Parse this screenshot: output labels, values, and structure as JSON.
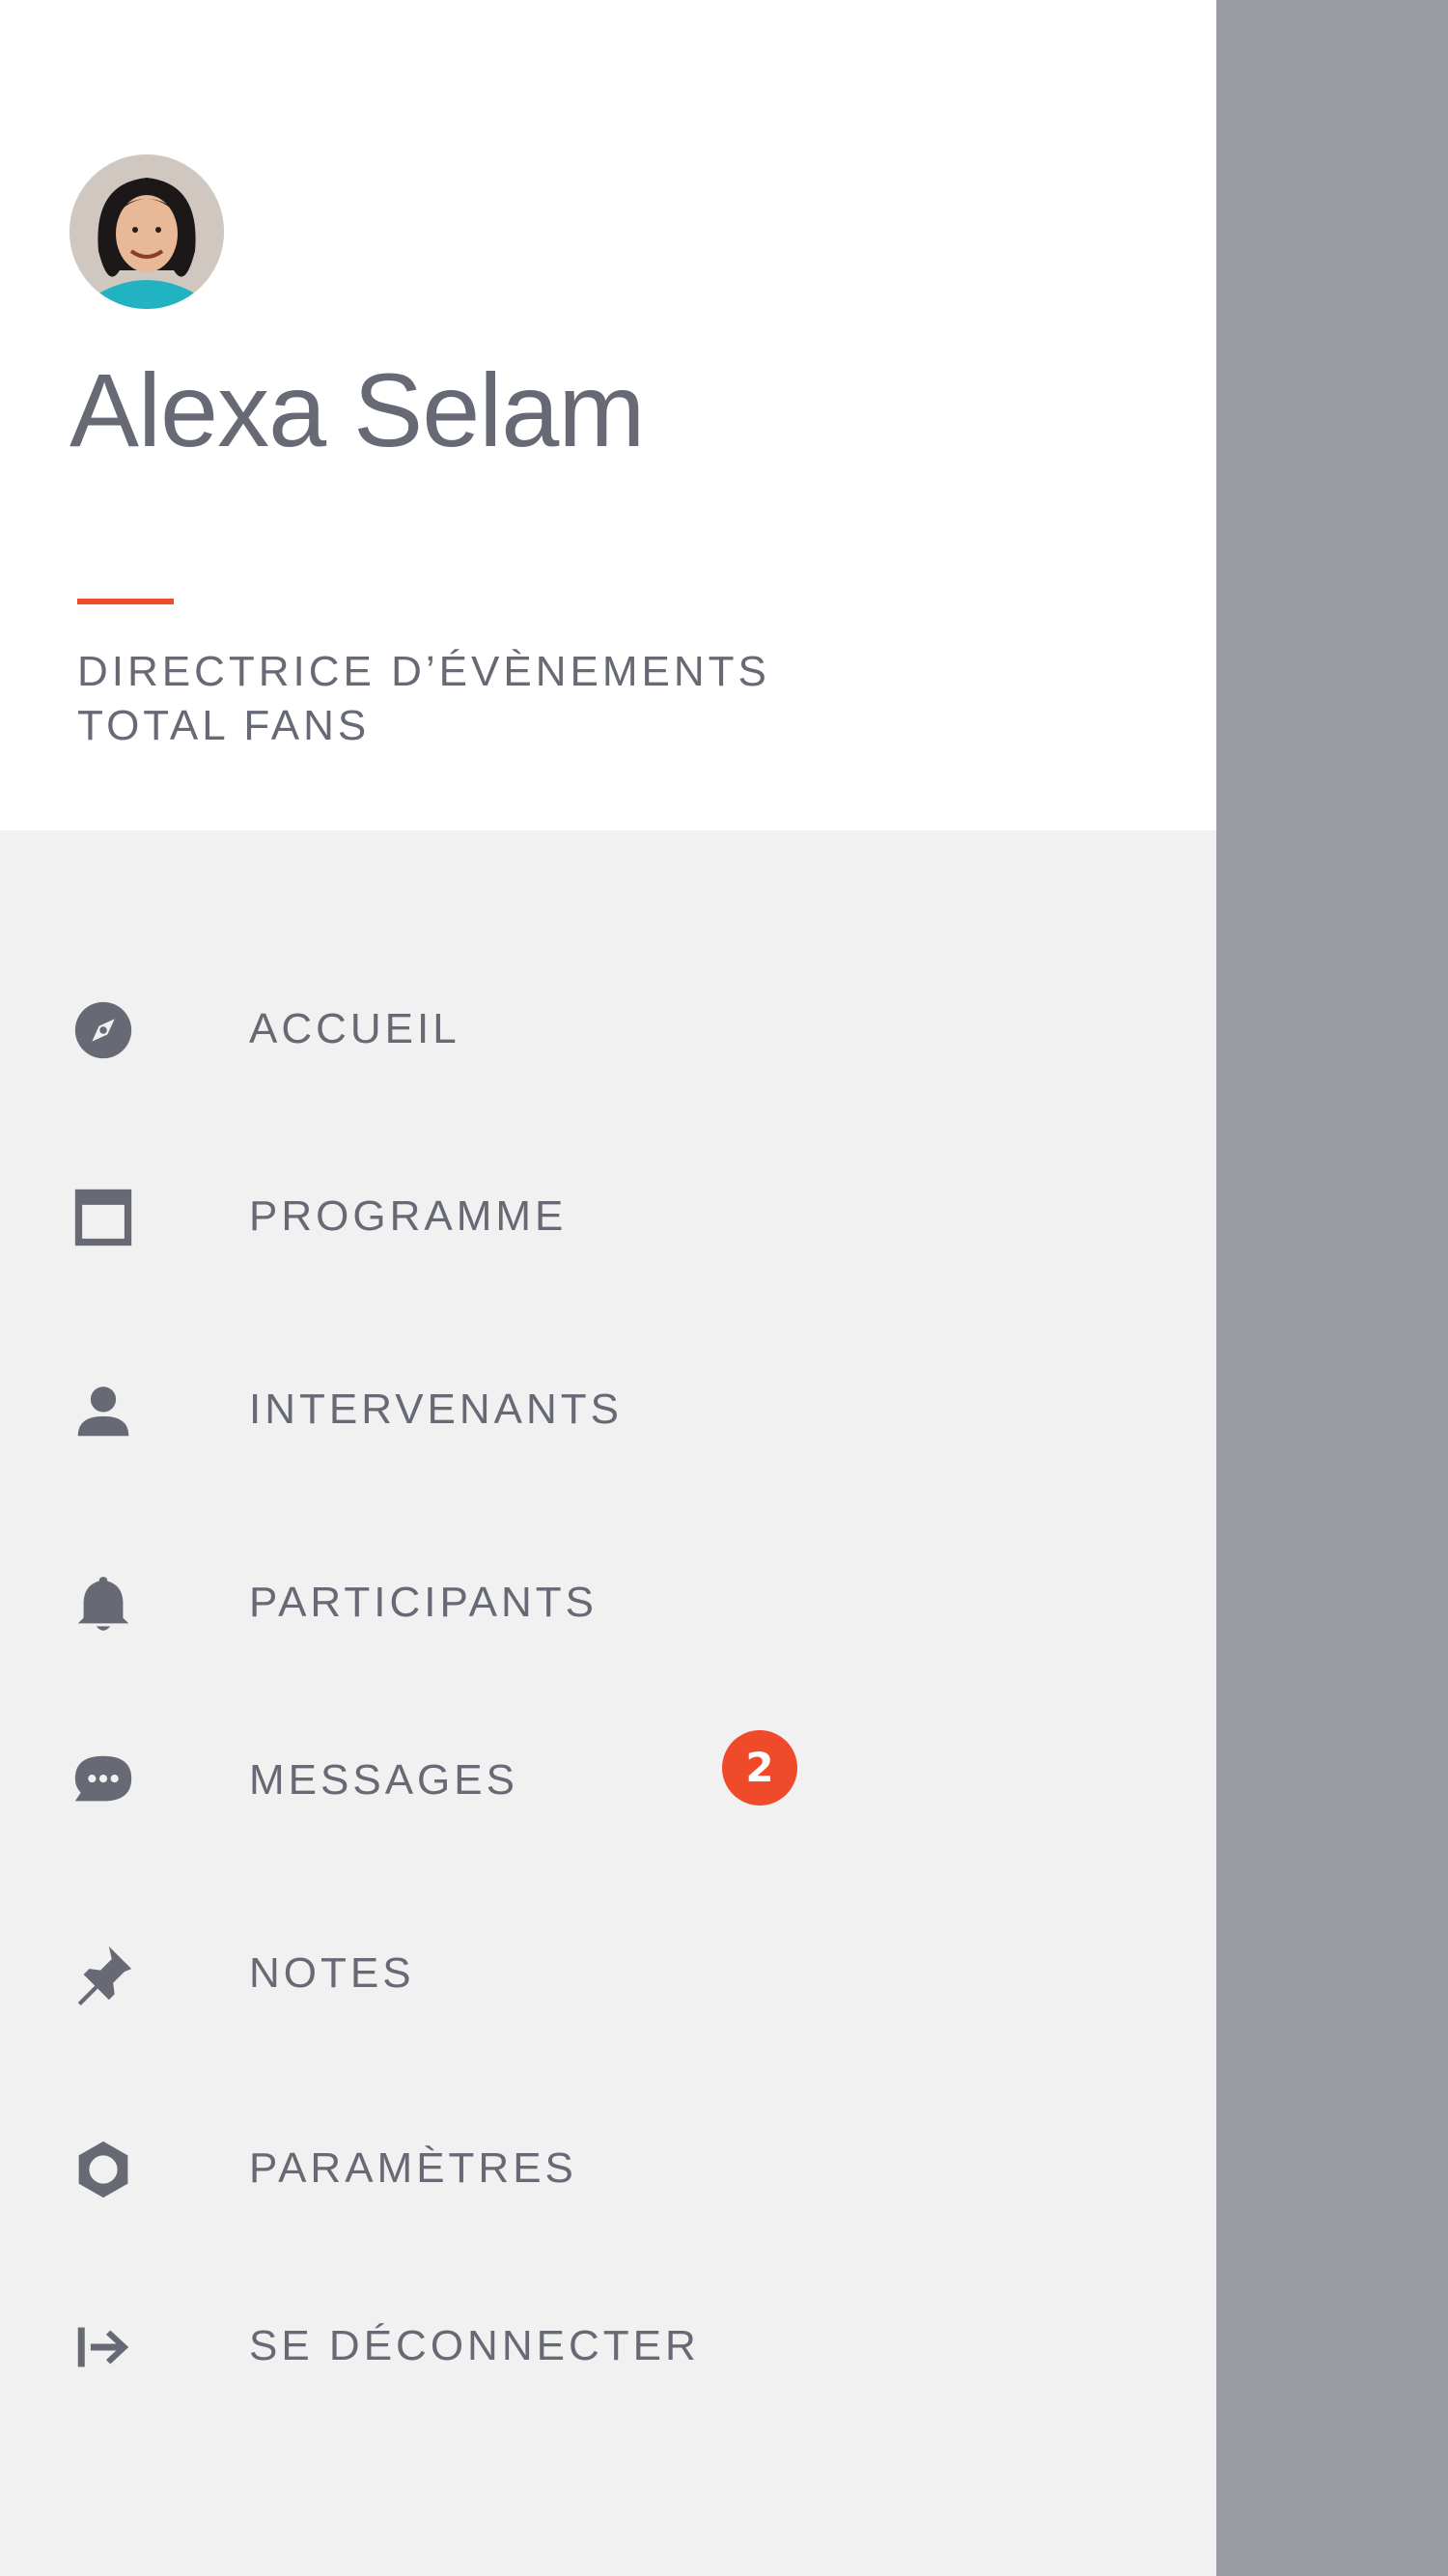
{
  "profile": {
    "name": "Alexa Selam",
    "role": "DIRECTRICE D’ÉVÈNEMENTS",
    "fans_label": "TOTAL FANS"
  },
  "colors": {
    "accent": "#ef4a2a",
    "text": "#676a75",
    "drawer_bg": "#f1f1f1",
    "header_bg": "#ffffff",
    "scrim": "#9a9ca4"
  },
  "menu": {
    "items": [
      {
        "label": "ACCUEIL",
        "icon": "compass-icon"
      },
      {
        "label": "PROGRAMME",
        "icon": "calendar-icon"
      },
      {
        "label": "INTERVENANTS",
        "icon": "person-icon"
      },
      {
        "label": "PARTICIPANTS",
        "icon": "bell-icon"
      },
      {
        "label": "MESSAGES",
        "icon": "chat-bubble-icon",
        "badge": "2"
      },
      {
        "label": "NOTES",
        "icon": "pin-icon"
      },
      {
        "label": "PARAMÈTRES",
        "icon": "gear-icon"
      },
      {
        "label": "SE DÉCONNECTER",
        "icon": "logout-icon"
      }
    ]
  }
}
